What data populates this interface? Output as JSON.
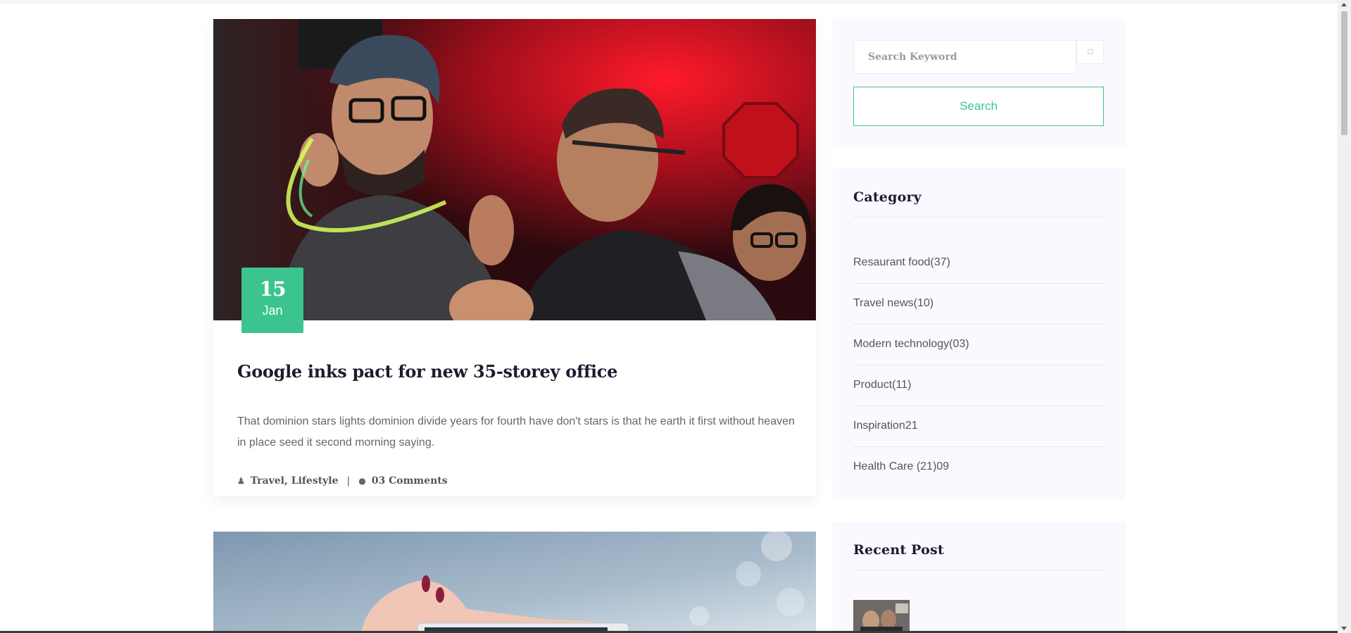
{
  "post": {
    "date_day": "15",
    "date_month": "Jan",
    "title": "Google inks pact for new 35-storey office",
    "excerpt": "That dominion stars lights dominion divide years for fourth have don't stars is that he earth it first without heaven in place seed it second morning saying.",
    "categories": "Travel, Lifestyle",
    "comments": "03 Comments",
    "meta_separator": "|",
    "image_alt": "Two men wearing glasses at a party with red lights"
  },
  "sidebar": {
    "search": {
      "placeholder": "Search Keyword",
      "button_label": "Search"
    },
    "category": {
      "title": "Category",
      "items": [
        "Resaurant food(37)",
        "Travel news(10)",
        "Modern technology(03)",
        "Product(11)",
        "Inspiration21",
        "Health Care (21)09"
      ]
    },
    "recent_post": {
      "title": "Recent Post"
    }
  },
  "colors": {
    "accent": "#3cc48f",
    "title": "#1c1c2e",
    "widget_bg": "#fbf9ff"
  }
}
